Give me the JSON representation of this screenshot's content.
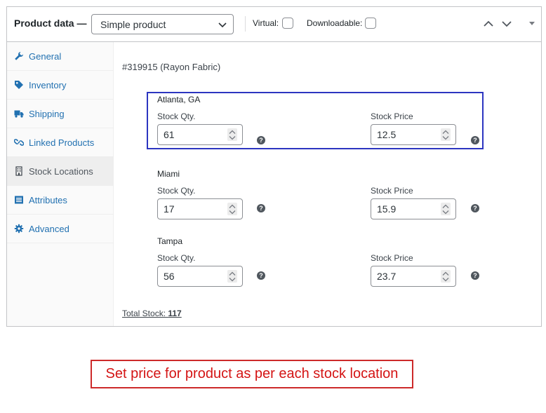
{
  "header": {
    "title": "Product data —",
    "product_type": "Simple product",
    "virtual_label": "Virtual:",
    "downloadable_label": "Downloadable:"
  },
  "sidebar": {
    "items": [
      {
        "label": "General",
        "icon": "wrench-icon",
        "active": false
      },
      {
        "label": "Inventory",
        "icon": "tag-icon",
        "active": false
      },
      {
        "label": "Shipping",
        "icon": "truck-icon",
        "active": false
      },
      {
        "label": "Linked Products",
        "icon": "link-icon",
        "active": false
      },
      {
        "label": "Stock Locations",
        "icon": "building-icon",
        "active": true
      },
      {
        "label": "Attributes",
        "icon": "list-icon",
        "active": false
      },
      {
        "label": "Advanced",
        "icon": "gear-icon",
        "active": false
      }
    ]
  },
  "product": {
    "sku": "#319915 (Rayon Fabric)"
  },
  "locations": [
    {
      "name": "Atlanta, GA",
      "qty_label": "Stock Qty.",
      "qty": "61",
      "price_label": "Stock Price",
      "price": "12.5",
      "highlighted": true
    },
    {
      "name": "Miami",
      "qty_label": "Stock Qty.",
      "qty": "17",
      "price_label": "Stock Price",
      "price": "15.9",
      "highlighted": false
    },
    {
      "name": "Tampa",
      "qty_label": "Stock Qty.",
      "qty": "56",
      "price_label": "Stock Price",
      "price": "23.7",
      "highlighted": false
    }
  ],
  "total": {
    "label": "Total Stock:",
    "value": "117"
  },
  "caption": "Set price for product as per each stock location",
  "colors": {
    "accent": "#2271b1",
    "highlight_border": "#2c35c0",
    "caption_red": "#d41414"
  }
}
